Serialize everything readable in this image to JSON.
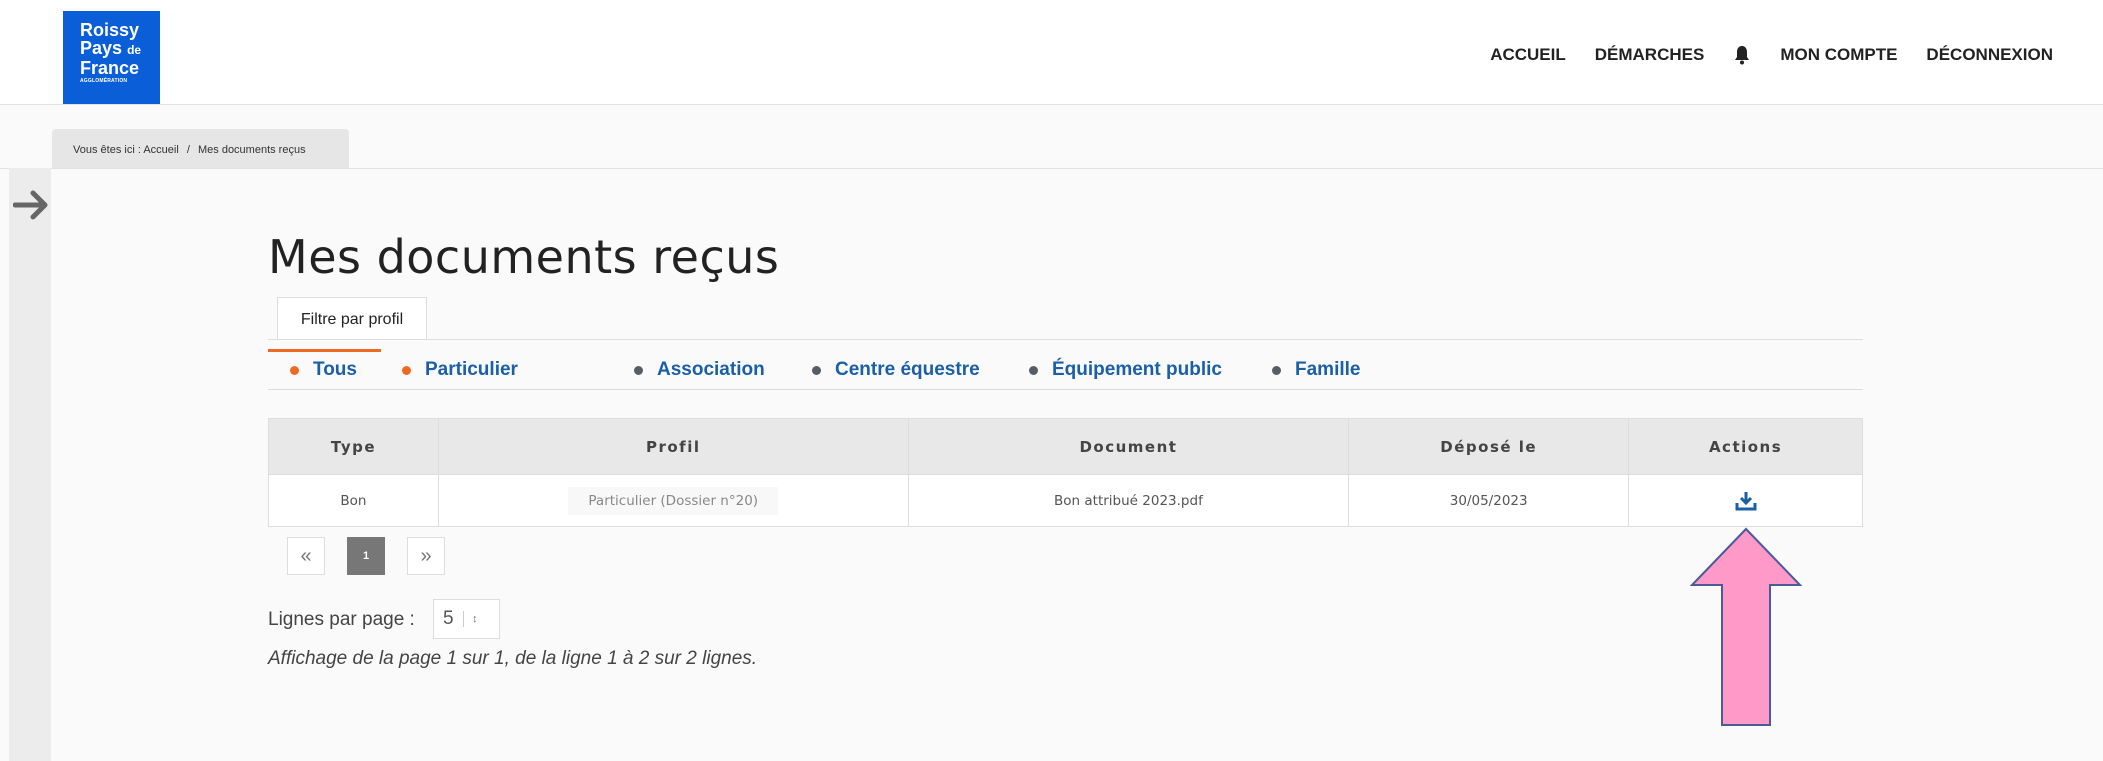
{
  "colors": {
    "brand_blue": "#0a5fd8",
    "accent_orange": "#ee6a22",
    "link_blue": "#1a5fa8",
    "annotation_pink": "#ff99c8"
  },
  "logo": {
    "line1": "Roissy",
    "line2": "Pays",
    "line2_small": "de",
    "line3": "France",
    "tagline": "AGGLOMÉRATION"
  },
  "nav": {
    "items": [
      "ACCUEIL",
      "DÉMARCHES",
      "MON COMPTE",
      "DÉCONNEXION"
    ],
    "notification_icon": "bell-icon"
  },
  "breadcrumb": {
    "prefix": "Vous êtes ici :",
    "home": "Accueil",
    "separator": "/",
    "current": "Mes documents reçus"
  },
  "page_title": "Mes documents reçus",
  "filter": {
    "tab_label": "Filtre par profil",
    "profiles": [
      {
        "label": "Tous",
        "dot": "orange",
        "active": true
      },
      {
        "label": "Particulier",
        "dot": "orange",
        "active": false
      },
      {
        "label": "Association",
        "dot": "grey",
        "active": false
      },
      {
        "label": "Centre équestre",
        "dot": "grey",
        "active": false
      },
      {
        "label": "Équipement public",
        "dot": "grey",
        "active": false
      },
      {
        "label": "Famille",
        "dot": "grey",
        "active": false
      }
    ]
  },
  "table": {
    "headers": [
      "Type",
      "Profil",
      "Document",
      "Déposé le",
      "Actions"
    ],
    "rows": [
      {
        "type": "Bon",
        "profil": "Particulier (Dossier n°20)",
        "document": "Bon attribué 2023.pdf",
        "depose_le": "30/05/2023",
        "action_icon": "download-icon"
      }
    ]
  },
  "pagination": {
    "prev": "«",
    "current_page": "1",
    "next": "»"
  },
  "rows_per_page": {
    "label": "Lignes par page :",
    "value": "5"
  },
  "summary": "Affichage de la page 1 sur 1, de la ligne 1 à 2 sur 2 lignes."
}
